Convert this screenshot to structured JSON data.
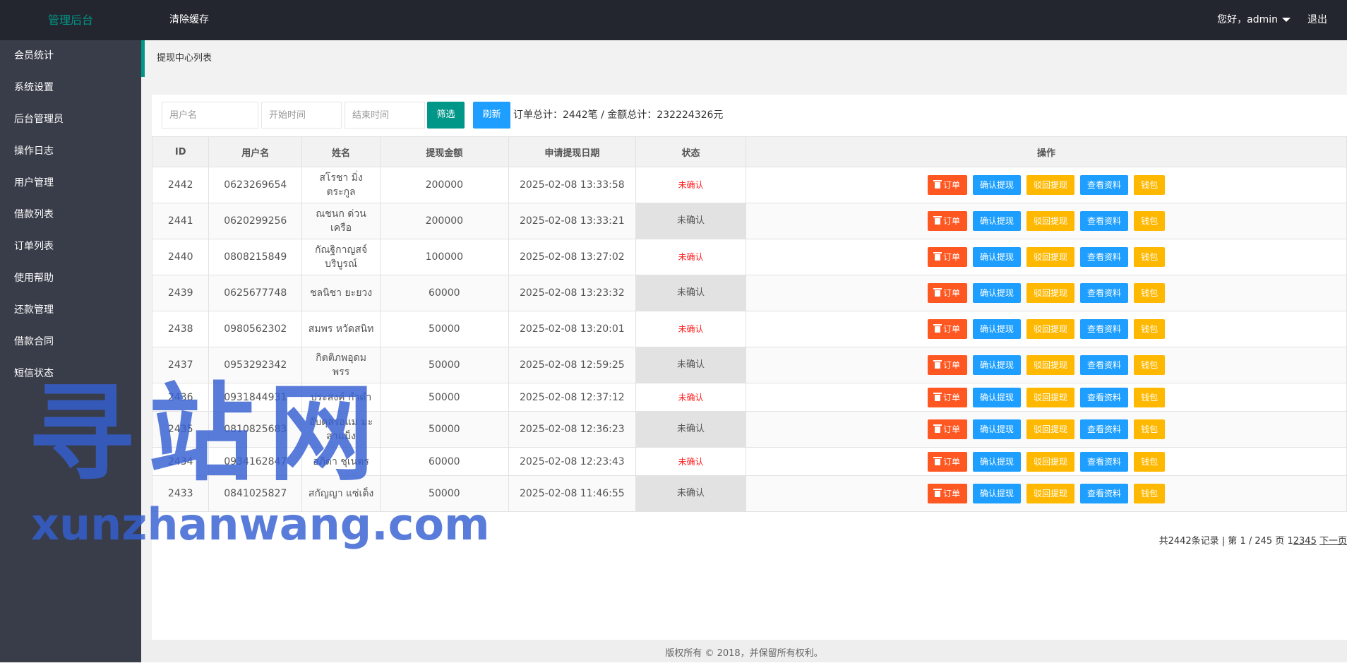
{
  "header": {
    "logo": "管理后台",
    "clear_cache": "清除缓存",
    "greeting": "您好，admin",
    "logout": "退出"
  },
  "sidebar": {
    "items": [
      {
        "label": "会员统计"
      },
      {
        "label": "系统设置"
      },
      {
        "label": "后台管理员"
      },
      {
        "label": "操作日志"
      },
      {
        "label": "用户管理"
      },
      {
        "label": "借款列表"
      },
      {
        "label": "订单列表"
      },
      {
        "label": "使用帮助"
      },
      {
        "label": "还款管理"
      },
      {
        "label": "借款合同"
      },
      {
        "label": "短信状态"
      }
    ]
  },
  "breadcrumb": "提现中心列表",
  "filters": {
    "username_placeholder": "用户名",
    "start_placeholder": "开始时间",
    "end_placeholder": "结束时间",
    "filter_label": "筛选",
    "refresh_label": "刷新",
    "summary": "订单总计：2442笔 / 金额总计：232224326元"
  },
  "table": {
    "columns": [
      "ID",
      "用户名",
      "姓名",
      "提现金额",
      "申请提现日期",
      "状态",
      "操作"
    ],
    "actions": {
      "order": "订单",
      "confirm": "确认提现",
      "reject": "驳回提现",
      "view": "查看资料",
      "wallet": "钱包"
    },
    "rows": [
      {
        "id": "2442",
        "username": "0623269654",
        "name": "สโรชา มิ่งตระกูล",
        "amount": "200000",
        "date": "2025-02-08 13:33:58",
        "status": "未确认",
        "status_style": "red"
      },
      {
        "id": "2441",
        "username": "0620299256",
        "name": "ณชนก ด่วนเครือ",
        "amount": "200000",
        "date": "2025-02-08 13:33:21",
        "status": "未确认",
        "status_style": "grey"
      },
      {
        "id": "2440",
        "username": "0808215849",
        "name": "กัณฐิกาญสจ์ บริบูรณ์",
        "amount": "100000",
        "date": "2025-02-08 13:27:02",
        "status": "未确认",
        "status_style": "red"
      },
      {
        "id": "2439",
        "username": "0625677748",
        "name": "ชลนิชา ยะยวง",
        "amount": "60000",
        "date": "2025-02-08 13:23:32",
        "status": "未确认",
        "status_style": "grey"
      },
      {
        "id": "2438",
        "username": "0980562302",
        "name": "สมพร หวัดสนิท",
        "amount": "50000",
        "date": "2025-02-08 13:20:01",
        "status": "未确认",
        "status_style": "red"
      },
      {
        "id": "2437",
        "username": "0953292342",
        "name": "กิตติภพอุดมพรร",
        "amount": "50000",
        "date": "2025-02-08 12:59:25",
        "status": "未确认",
        "status_style": "grey"
      },
      {
        "id": "2436",
        "username": "0931844931",
        "name": "ประสงค์ กำดำ",
        "amount": "50000",
        "date": "2025-02-08 12:37:12",
        "status": "未确认",
        "status_style": "red"
      },
      {
        "id": "2435",
        "username": "0810825683",
        "name": "อับดุลรอแม มะสาแม็ง",
        "amount": "50000",
        "date": "2025-02-08 12:36:23",
        "status": "未确认",
        "status_style": "grey"
      },
      {
        "id": "2434",
        "username": "0934162847",
        "name": "อภิดา ชุเนตร",
        "amount": "60000",
        "date": "2025-02-08 12:23:43",
        "status": "未确认",
        "status_style": "red"
      },
      {
        "id": "2433",
        "username": "0841025827",
        "name": "สกัญญา แซ่เต็ง",
        "amount": "50000",
        "date": "2025-02-08 11:46:55",
        "status": "未确认",
        "status_style": "grey"
      }
    ]
  },
  "pagination": {
    "summary": "共2442条记录 | 第 1 / 245 页 ",
    "pages": [
      "1",
      "2",
      "3",
      "4",
      "5"
    ],
    "next": "下一页"
  },
  "footer": "版权所有 © 2018，并保留所有权利。",
  "watermark": {
    "big": "寻站网",
    "small": "xunzhanwang.com"
  },
  "colors": {
    "topbar": "#23262e",
    "sidebar": "#393d49",
    "accent": "#009688",
    "blue": "#1e9fff",
    "orange_red": "#ff5722",
    "yellow": "#ffb800",
    "status_red": "#ff1e1e"
  },
  "icons": {
    "order_button": "trash-icon",
    "user_menu": "caret-down-icon"
  }
}
